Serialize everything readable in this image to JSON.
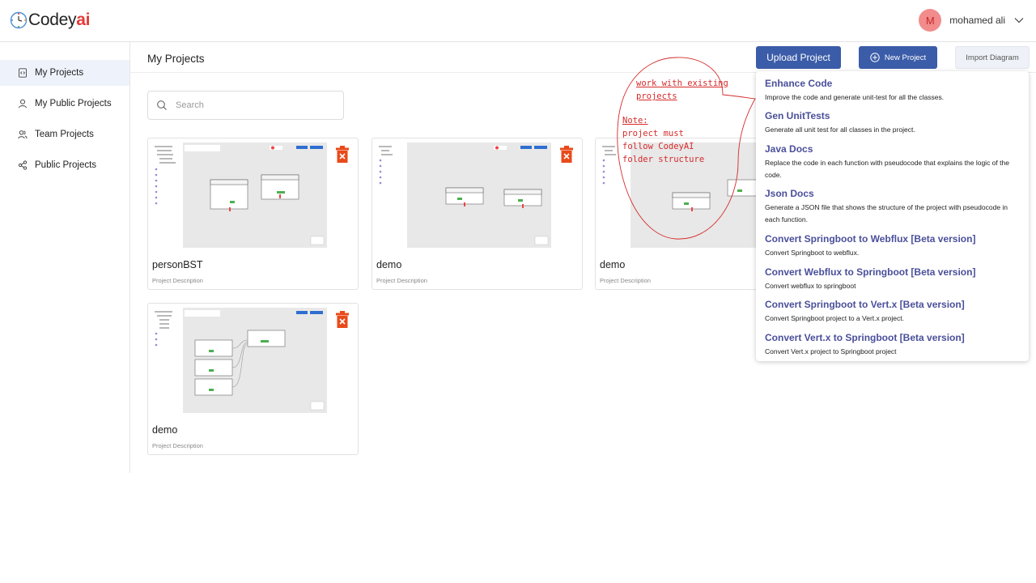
{
  "brand": {
    "part1": "Codey",
    "part2": "ai"
  },
  "user": {
    "initial": "M",
    "name": "mohamed ali"
  },
  "sidebar": {
    "items": [
      {
        "label": "My Projects",
        "icon": "code-file-icon"
      },
      {
        "label": "My Public Projects",
        "icon": "user-icon"
      },
      {
        "label": "Team Projects",
        "icon": "team-icon"
      },
      {
        "label": "Public Projects",
        "icon": "share-icon"
      }
    ]
  },
  "header": {
    "title": "My Projects",
    "upload_label": "Upload Project",
    "new_label": "New Project",
    "import_label": "Import Diagram"
  },
  "search": {
    "placeholder": "Search"
  },
  "projects": [
    {
      "title": "personBST",
      "description": "Project Description"
    },
    {
      "title": "demo",
      "description": "Project Description"
    },
    {
      "title": "demo",
      "description": "Project Description"
    },
    {
      "title": "demo",
      "description": "Project Description"
    }
  ],
  "menu": [
    {
      "title": "Enhance Code",
      "description": "Improve the code and generate unit-test for all the classes."
    },
    {
      "title": "Gen UnitTests",
      "description": "Generate all unit test for all classes in the project."
    },
    {
      "title": "Java Docs",
      "description": "Replace the code in each function with pseudocode that explains the logic of the code."
    },
    {
      "title": "Json Docs",
      "description": "Generate a JSON file that shows the structure of the project with pseudocode in each function."
    },
    {
      "title": "Convert Springboot to Webflux [Beta version]",
      "description": "Convert Springboot to webflux."
    },
    {
      "title": "Convert Webflux to Springboot [Beta version]",
      "description": "Convert webflux to springboot"
    },
    {
      "title": "Convert Springboot to Vert.x [Beta version]",
      "description": "Convert Springboot project to a Vert.x project."
    },
    {
      "title": "Convert Vert.x to Springboot [Beta version]",
      "description": "Convert Vert.x project to Springboot project"
    }
  ],
  "annotation": {
    "line1": "work with existing",
    "line2": "projects",
    "note_label": "Note:",
    "note1": "project must",
    "note2": "follow CodeyAI",
    "note3": "folder structure",
    "color": "#d62a2a"
  },
  "colors": {
    "primary": "#3b5ca8",
    "menu_title": "#4a4f9a",
    "delete": "#e84a1a",
    "active_nav": "#eef3fb"
  }
}
